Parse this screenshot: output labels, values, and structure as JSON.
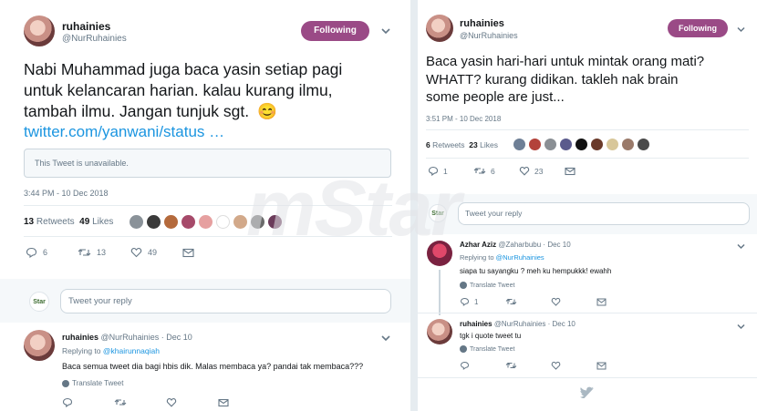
{
  "left": {
    "main": {
      "name": "ruhainies",
      "handle": "@NurRuhainies",
      "follow_label": "Following",
      "text_line1": "Nabi Muhammad juga baca yasin setiap pagi",
      "text_line2": "untuk kelancaran harian. kalau kurang ilmu,",
      "text_line3": "tambah ilmu. Jangan tunjuk sgt.",
      "emoji": "😊",
      "link": "twitter.com/yanwani/status …",
      "unavailable": "This Tweet is unavailable.",
      "timestamp": "3:44 PM - 10 Dec 2018",
      "retweets_count": "13",
      "retweets_label": "Retweets",
      "likes_count": "49",
      "likes_label": "Likes",
      "reply_count": "6",
      "retweet_count": "13",
      "like_count": "49"
    },
    "reply_box": {
      "logo": "Star",
      "placeholder": "Tweet your reply"
    },
    "reply": {
      "name": "ruhainies",
      "handle_date": "@NurRuhainies · Dec 10",
      "replying_prefix": "Replying to",
      "replying_to": "@khairunnaqiah",
      "text": "Baca semua tweet dia bagi hbis dik. Malas membaca ya? pandai tak membaca???",
      "translate": "Translate Tweet"
    }
  },
  "right": {
    "main": {
      "name": "ruhainies",
      "handle": "@NurRuhainies",
      "follow_label": "Following",
      "text_line1": "Baca yasin hari-hari untuk mintak orang mati?",
      "text_line2": "WHATT? kurang didikan. takleh nak brain",
      "text_line3": "some people are just...",
      "timestamp": "3:51 PM - 10 Dec 2018",
      "retweets_count": "6",
      "retweets_label": "Retweets",
      "likes_count": "23",
      "likes_label": "Likes",
      "reply_count": "1",
      "retweet_count": "6",
      "like_count": "23"
    },
    "reply_box": {
      "logo": "Star",
      "placeholder": "Tweet your reply"
    },
    "reply1": {
      "name": "Azhar Aziz",
      "handle_date": "@Zaharbubu · Dec 10",
      "replying_prefix": "Replying to",
      "replying_to": "@NurRuhainies",
      "text": "siapa tu sayangku ? meh ku hempukkk! ewahh",
      "translate": "Translate Tweet",
      "reply_count": "1"
    },
    "reply2": {
      "name": "ruhainies",
      "handle_date": "@NurRuhainies · Dec 10",
      "text": "tgk i quote tweet tu",
      "translate": "Translate Tweet"
    }
  },
  "watermark": "mStar",
  "colors": {
    "follow": "#9a4a86",
    "link": "#1b95e0",
    "muted": "#657786",
    "background": "#e6ecf0"
  },
  "icons": [
    "reply-icon",
    "retweet-icon",
    "like-icon",
    "message-icon",
    "chevron-down-icon",
    "globe-icon",
    "twitter-bird-icon"
  ]
}
